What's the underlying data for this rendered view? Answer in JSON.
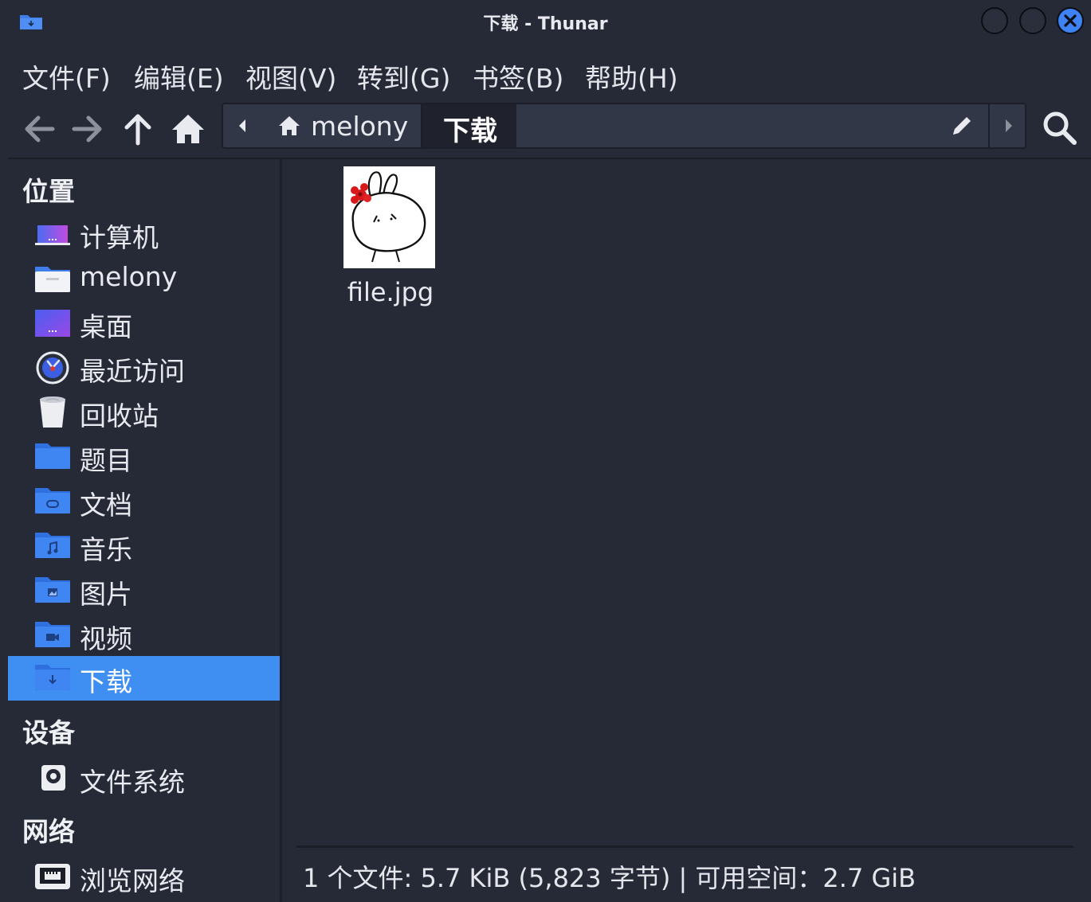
{
  "window": {
    "title": "下载 - Thunar",
    "accent": "#3f8ef1",
    "close_color": "#3e82f4"
  },
  "menubar": {
    "items": [
      "文件(F)",
      "编辑(E)",
      "视图(V)",
      "转到(G)",
      "书签(B)",
      "帮助(H)"
    ]
  },
  "toolbar": {
    "back_icon": "arrow-left-icon",
    "forward_icon": "arrow-right-icon",
    "up_icon": "arrow-up-icon",
    "home_icon": "home-icon",
    "search_icon": "search-icon"
  },
  "pathbar": {
    "home_crumb": "melony",
    "current_crumb": "下载",
    "edit_icon": "pencil-icon"
  },
  "sidebar": {
    "places_title": "位置",
    "places": [
      {
        "label": "计算机",
        "icon": "computer-icon"
      },
      {
        "label": "melony",
        "icon": "home-folder-icon"
      },
      {
        "label": "桌面",
        "icon": "desktop-icon"
      },
      {
        "label": "最近访问",
        "icon": "clock-icon"
      },
      {
        "label": "回收站",
        "icon": "trash-icon"
      },
      {
        "label": "题目",
        "icon": "folder-icon"
      },
      {
        "label": "文档",
        "icon": "documents-folder-icon"
      },
      {
        "label": "音乐",
        "icon": "music-folder-icon"
      },
      {
        "label": "图片",
        "icon": "pictures-folder-icon"
      },
      {
        "label": "视频",
        "icon": "videos-folder-icon"
      },
      {
        "label": "下载",
        "icon": "downloads-folder-icon",
        "selected": true
      }
    ],
    "devices_title": "设备",
    "devices": [
      {
        "label": "文件系统",
        "icon": "drive-icon"
      }
    ],
    "network_title": "网络",
    "network": [
      {
        "label": "浏览网络",
        "icon": "network-icon"
      }
    ]
  },
  "main": {
    "files": [
      {
        "name": "file.jpg",
        "icon": "image-thumbnail-icon"
      }
    ]
  },
  "statusbar": {
    "text": "1 个文件: 5.7 KiB (5,823 字节)  |  可用空间：2.7 GiB"
  }
}
